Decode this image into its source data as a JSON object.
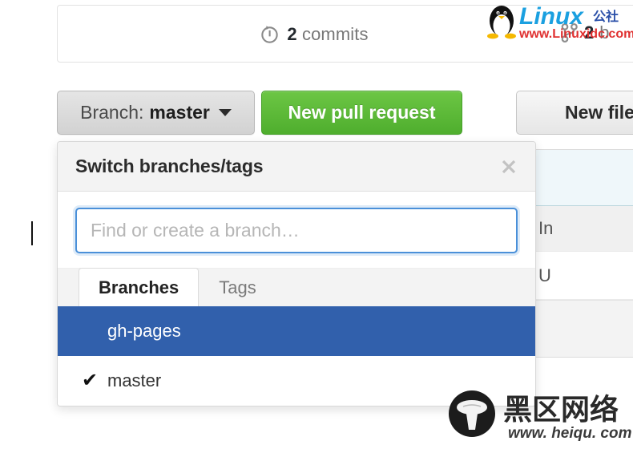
{
  "repo": {
    "commits": {
      "count": "2",
      "label": "commits",
      "icon": "history-icon"
    },
    "branches_counter": {
      "count": "2",
      "label": "b",
      "icon": "git-branch-icon"
    }
  },
  "toolbar": {
    "branch_button": {
      "prefix": "Branch:",
      "value": "master",
      "caret_icon": "caret-down-icon"
    },
    "new_pull_request_label": "New pull request",
    "new_file_label": "New file"
  },
  "file_table": {
    "rows": [
      {
        "text": "In"
      },
      {
        "text": "U"
      }
    ]
  },
  "dropdown": {
    "title": "Switch branches/tags",
    "close_icon": "close-icon",
    "search": {
      "value": "",
      "placeholder": "Find or create a branch…"
    },
    "tabs": [
      {
        "label": "Branches",
        "active": true
      },
      {
        "label": "Tags",
        "active": false
      }
    ],
    "items": [
      {
        "name": "gh-pages",
        "checked": false,
        "selected": true,
        "check_glyph": "✔"
      },
      {
        "name": "master",
        "checked": true,
        "selected": false,
        "check_glyph": "✔"
      }
    ]
  },
  "watermarks": {
    "top": {
      "brand": "Linux",
      "brand_suffix": "公社",
      "url": "www.Linuxidc.com",
      "icon": "tux-penguin-icon"
    },
    "bottom": {
      "brand": "黑区网络",
      "url": "www.heiqu.com",
      "icon": "mushroom-icon"
    }
  },
  "colors": {
    "selected_blue": "#3160ac",
    "green_button": "#6cc644",
    "focus_blue": "#4a90d9",
    "table_header_blue": "#eff7fa"
  }
}
